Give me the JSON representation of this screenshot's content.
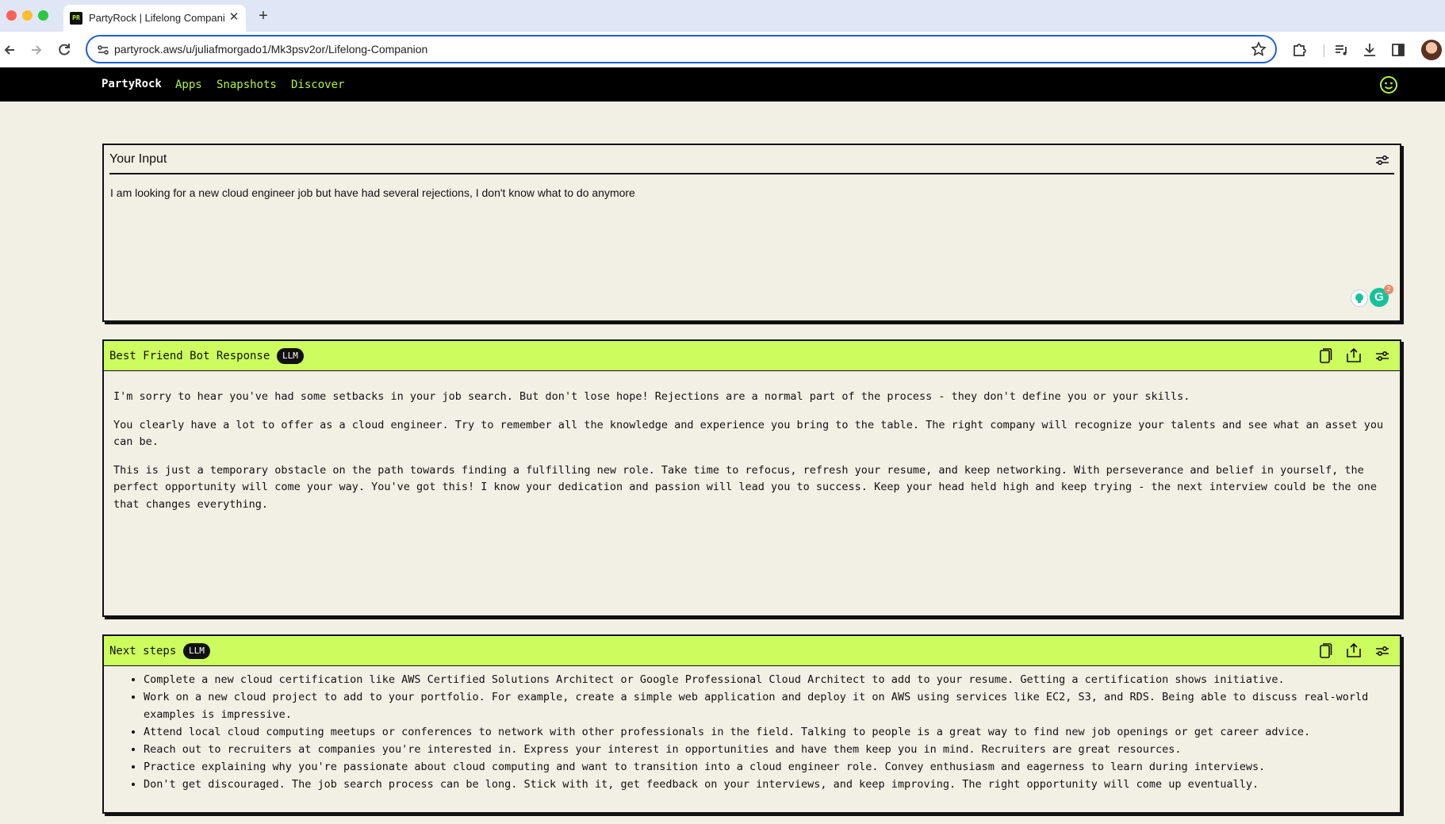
{
  "browser": {
    "tab_favicon": "PR",
    "tab_title": "PartyRock | Lifelong Companion",
    "tab_close": "✕",
    "new_tab": "+",
    "url": "partyrock.aws/u/juliafmorgado1/Mk3psv2or/Lifelong-Companion",
    "icons": [
      "back-icon",
      "forward-icon",
      "reload-icon",
      "site-info-icon",
      "bookmark-star-icon",
      "extensions-icon",
      "media-controls-icon",
      "download-icon",
      "side-panel-icon",
      "profile-avatar"
    ]
  },
  "appnav": {
    "brand": "PartyRock",
    "links": [
      "Apps",
      "Snapshots",
      "Discover"
    ],
    "accent_color": "#b5f33c"
  },
  "input_widget": {
    "title": "Your Input",
    "value": "I am looking for a new cloud engineer job but have had several rejections, I don't know what to do anymore",
    "grammarly_count": "2"
  },
  "response_widget": {
    "title": "Best Friend Bot Response",
    "badge": "LLM",
    "header_color": "#cdfc5e",
    "paragraphs": [
      "I'm sorry to hear you've had some setbacks in your job search. But don't lose hope! Rejections are a normal part of the process - they don't define you or your skills.",
      "You clearly have a lot to offer as a cloud engineer. Try to remember all the knowledge and experience you bring to the table. The right company will recognize your talents and see what an asset you can be.",
      "This is just a temporary obstacle on the path towards finding a fulfilling new role. Take time to refocus, refresh your resume, and keep networking. With perseverance and belief in yourself, the perfect opportunity will come your way. You've got this! I know your dedication and passion will lead you to success. Keep your head held high and keep trying - the next interview could be the one that changes everything."
    ]
  },
  "steps_widget": {
    "title": "Next steps",
    "badge": "LLM",
    "items": [
      "Complete a new cloud certification like AWS Certified Solutions Architect or Google Professional Cloud Architect to add to your resume. Getting a certification shows initiative.",
      "Work on a new cloud project to add to your portfolio. For example, create a simple web application and deploy it on AWS using services like EC2, S3, and RDS. Being able to discuss real-world examples is impressive.",
      "Attend local cloud computing meetups or conferences to network with other professionals in the field. Talking to people is a great way to find new job openings or get career advice.",
      "Reach out to recruiters at companies you're interested in. Express your interest in opportunities and have them keep you in mind. Recruiters are great resources.",
      "Practice explaining why you're passionate about cloud computing and want to transition into a cloud engineer role. Convey enthusiasm and eagerness to learn during interviews.",
      "Don't get discouraged. The job search process can be long. Stick with it, get feedback on your interviews, and keep improving. The right opportunity will come up eventually."
    ]
  }
}
